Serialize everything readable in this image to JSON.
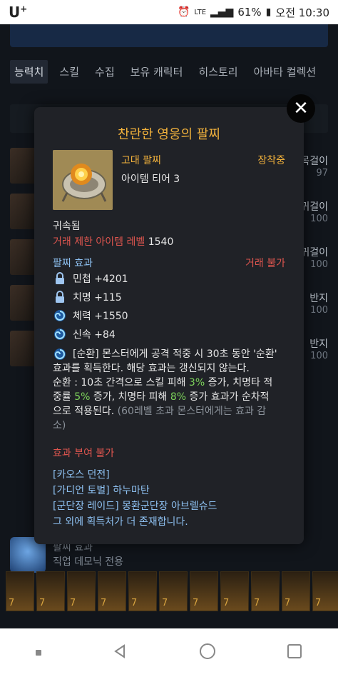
{
  "status_bar": {
    "carrier": "U",
    "carrier_sup": "+",
    "network": "LTE",
    "battery": "61%",
    "time": "오전 10:30"
  },
  "tabs": [
    "능력치",
    "스킬",
    "수집",
    "보유 캐릭터",
    "히스토리",
    "아바타 컬렉션"
  ],
  "background_list": [
    {
      "name": "목걸이",
      "value": "97"
    },
    {
      "name": "귀걸이",
      "value": "100"
    },
    {
      "name": "귀걸이",
      "value": "100"
    },
    {
      "name": "반지",
      "value": "100"
    },
    {
      "name": "반지",
      "value": "100"
    }
  ],
  "bottom_info": {
    "line1": "팔찌 효과",
    "line2": "직업 데모닉 전용"
  },
  "cards": [
    "7",
    "7",
    "7",
    "7",
    "7",
    "7",
    "7",
    "7",
    "7",
    "7",
    "7"
  ],
  "modal": {
    "title": "찬란한 영웅의 팔찌",
    "grade": "고대 팔찌",
    "equipped": "장착중",
    "tier": "아이템 티어 3",
    "bound": "귀속됨",
    "trade_limit_label": "거래 제한 아이템 레벨",
    "trade_limit_value": "1540",
    "effect_head": "팔찌 효과",
    "trade_no": "거래 불가",
    "stats": [
      {
        "icon": "lock-icon",
        "text": "민첩 +4201"
      },
      {
        "icon": "lock-icon",
        "text": "치명 +115"
      },
      {
        "icon": "swirl-icon",
        "text": "체력 +1550"
      },
      {
        "icon": "swirl-icon",
        "text": "신속 +84"
      }
    ],
    "special": {
      "line1": "[순환] 몬스터에게 공격 적중 시 30초 동안 '순환'",
      "line2": "효과를 획득한다. 해당 효과는 갱신되지 않는다.",
      "line3a": "순환 : 10초 간격으로 스킬 피해 ",
      "line3b": "3%",
      "line3c": " 증가, 치명타 적",
      "line4a": "중률 ",
      "line4b": "5%",
      "line4c": " 증가, 치명타 피해 ",
      "line4d": "8%",
      "line4e": " 증가 효과가 순차적",
      "line5a": "으로 적용된다. ",
      "line5b": "(60레벨 초과 몬스터에게는 효과 감",
      "line6": "소)"
    },
    "no_grant": "효과 부여 불가",
    "sources": [
      "[카오스 던전]",
      "[가디언 토벌] 하누마탄",
      "[군단장 레이드] 몽환군단장 아브렐슈드",
      "그 외에 획득처가 더 존재합니다."
    ]
  },
  "colors": {
    "accent_gold": "#f2b23c",
    "red": "#e0564f",
    "blue": "#8ec1f2",
    "green": "#7dd35b"
  }
}
